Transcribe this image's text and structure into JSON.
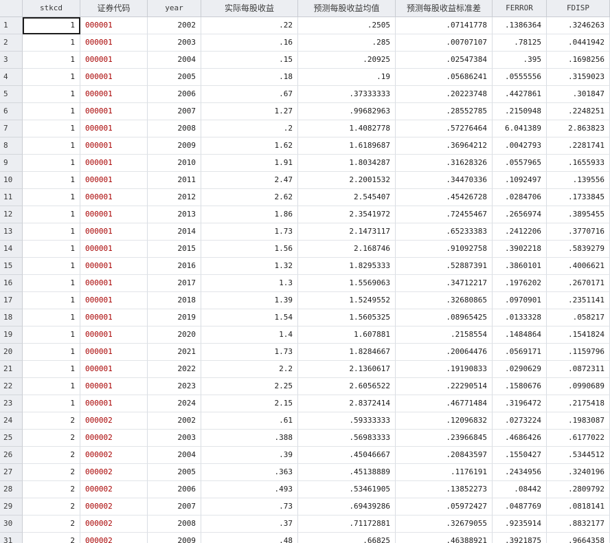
{
  "columns": [
    "stkcd",
    "证券代码",
    "year",
    "实际每股收益",
    "预测每股收益均值",
    "预测每股收益标准差",
    "FERROR",
    "FDISP"
  ],
  "rows": [
    {
      "n": "1",
      "stkcd": "1",
      "code": "000001",
      "year": "2002",
      "eps": ".22",
      "fmean": ".2505",
      "fsd": ".07141778",
      "ferror": ".1386364",
      "fdisp": ".3246263"
    },
    {
      "n": "2",
      "stkcd": "1",
      "code": "000001",
      "year": "2003",
      "eps": ".16",
      "fmean": ".285",
      "fsd": ".00707107",
      "ferror": ".78125",
      "fdisp": ".0441942"
    },
    {
      "n": "3",
      "stkcd": "1",
      "code": "000001",
      "year": "2004",
      "eps": ".15",
      "fmean": ".20925",
      "fsd": ".02547384",
      "ferror": ".395",
      "fdisp": ".1698256"
    },
    {
      "n": "4",
      "stkcd": "1",
      "code": "000001",
      "year": "2005",
      "eps": ".18",
      "fmean": ".19",
      "fsd": ".05686241",
      "ferror": ".0555556",
      "fdisp": ".3159023"
    },
    {
      "n": "5",
      "stkcd": "1",
      "code": "000001",
      "year": "2006",
      "eps": ".67",
      "fmean": ".37333333",
      "fsd": ".20223748",
      "ferror": ".4427861",
      "fdisp": ".301847"
    },
    {
      "n": "6",
      "stkcd": "1",
      "code": "000001",
      "year": "2007",
      "eps": "1.27",
      "fmean": ".99682963",
      "fsd": ".28552785",
      "ferror": ".2150948",
      "fdisp": ".2248251"
    },
    {
      "n": "7",
      "stkcd": "1",
      "code": "000001",
      "year": "2008",
      "eps": ".2",
      "fmean": "1.4082778",
      "fsd": ".57276464",
      "ferror": "6.041389",
      "fdisp": "2.863823"
    },
    {
      "n": "8",
      "stkcd": "1",
      "code": "000001",
      "year": "2009",
      "eps": "1.62",
      "fmean": "1.6189687",
      "fsd": ".36964212",
      "ferror": ".0042793",
      "fdisp": ".2281741"
    },
    {
      "n": "9",
      "stkcd": "1",
      "code": "000001",
      "year": "2010",
      "eps": "1.91",
      "fmean": "1.8034287",
      "fsd": ".31628326",
      "ferror": ".0557965",
      "fdisp": ".1655933"
    },
    {
      "n": "10",
      "stkcd": "1",
      "code": "000001",
      "year": "2011",
      "eps": "2.47",
      "fmean": "2.2001532",
      "fsd": ".34470336",
      "ferror": ".1092497",
      "fdisp": ".139556"
    },
    {
      "n": "11",
      "stkcd": "1",
      "code": "000001",
      "year": "2012",
      "eps": "2.62",
      "fmean": "2.545407",
      "fsd": ".45426728",
      "ferror": ".0284706",
      "fdisp": ".1733845"
    },
    {
      "n": "12",
      "stkcd": "1",
      "code": "000001",
      "year": "2013",
      "eps": "1.86",
      "fmean": "2.3541972",
      "fsd": ".72455467",
      "ferror": ".2656974",
      "fdisp": ".3895455"
    },
    {
      "n": "13",
      "stkcd": "1",
      "code": "000001",
      "year": "2014",
      "eps": "1.73",
      "fmean": "2.1473117",
      "fsd": ".65233383",
      "ferror": ".2412206",
      "fdisp": ".3770716"
    },
    {
      "n": "14",
      "stkcd": "1",
      "code": "000001",
      "year": "2015",
      "eps": "1.56",
      "fmean": "2.168746",
      "fsd": ".91092758",
      "ferror": ".3902218",
      "fdisp": ".5839279"
    },
    {
      "n": "15",
      "stkcd": "1",
      "code": "000001",
      "year": "2016",
      "eps": "1.32",
      "fmean": "1.8295333",
      "fsd": ".52887391",
      "ferror": ".3860101",
      "fdisp": ".4006621"
    },
    {
      "n": "16",
      "stkcd": "1",
      "code": "000001",
      "year": "2017",
      "eps": "1.3",
      "fmean": "1.5569063",
      "fsd": ".34712217",
      "ferror": ".1976202",
      "fdisp": ".2670171"
    },
    {
      "n": "17",
      "stkcd": "1",
      "code": "000001",
      "year": "2018",
      "eps": "1.39",
      "fmean": "1.5249552",
      "fsd": ".32680865",
      "ferror": ".0970901",
      "fdisp": ".2351141"
    },
    {
      "n": "18",
      "stkcd": "1",
      "code": "000001",
      "year": "2019",
      "eps": "1.54",
      "fmean": "1.5605325",
      "fsd": ".08965425",
      "ferror": ".0133328",
      "fdisp": ".058217"
    },
    {
      "n": "19",
      "stkcd": "1",
      "code": "000001",
      "year": "2020",
      "eps": "1.4",
      "fmean": "1.607881",
      "fsd": ".2158554",
      "ferror": ".1484864",
      "fdisp": ".1541824"
    },
    {
      "n": "20",
      "stkcd": "1",
      "code": "000001",
      "year": "2021",
      "eps": "1.73",
      "fmean": "1.8284667",
      "fsd": ".20064476",
      "ferror": ".0569171",
      "fdisp": ".1159796"
    },
    {
      "n": "21",
      "stkcd": "1",
      "code": "000001",
      "year": "2022",
      "eps": "2.2",
      "fmean": "2.1360617",
      "fsd": ".19190833",
      "ferror": ".0290629",
      "fdisp": ".0872311"
    },
    {
      "n": "22",
      "stkcd": "1",
      "code": "000001",
      "year": "2023",
      "eps": "2.25",
      "fmean": "2.6056522",
      "fsd": ".22290514",
      "ferror": ".1580676",
      "fdisp": ".0990689"
    },
    {
      "n": "23",
      "stkcd": "1",
      "code": "000001",
      "year": "2024",
      "eps": "2.15",
      "fmean": "2.8372414",
      "fsd": ".46771484",
      "ferror": ".3196472",
      "fdisp": ".2175418"
    },
    {
      "n": "24",
      "stkcd": "2",
      "code": "000002",
      "year": "2002",
      "eps": ".61",
      "fmean": ".59333333",
      "fsd": ".12096832",
      "ferror": ".0273224",
      "fdisp": ".1983087"
    },
    {
      "n": "25",
      "stkcd": "2",
      "code": "000002",
      "year": "2003",
      "eps": ".388",
      "fmean": ".56983333",
      "fsd": ".23966845",
      "ferror": ".4686426",
      "fdisp": ".6177022"
    },
    {
      "n": "26",
      "stkcd": "2",
      "code": "000002",
      "year": "2004",
      "eps": ".39",
      "fmean": ".45046667",
      "fsd": ".20843597",
      "ferror": ".1550427",
      "fdisp": ".5344512"
    },
    {
      "n": "27",
      "stkcd": "2",
      "code": "000002",
      "year": "2005",
      "eps": ".363",
      "fmean": ".45138889",
      "fsd": ".1176191",
      "ferror": ".2434956",
      "fdisp": ".3240196"
    },
    {
      "n": "28",
      "stkcd": "2",
      "code": "000002",
      "year": "2006",
      "eps": ".493",
      "fmean": ".53461905",
      "fsd": ".13852273",
      "ferror": ".08442",
      "fdisp": ".2809792"
    },
    {
      "n": "29",
      "stkcd": "2",
      "code": "000002",
      "year": "2007",
      "eps": ".73",
      "fmean": ".69439286",
      "fsd": ".05972427",
      "ferror": ".0487769",
      "fdisp": ".0818141"
    },
    {
      "n": "30",
      "stkcd": "2",
      "code": "000002",
      "year": "2008",
      "eps": ".37",
      "fmean": ".71172881",
      "fsd": ".32679055",
      "ferror": ".9235914",
      "fdisp": ".8832177"
    },
    {
      "n": "31",
      "stkcd": "2",
      "code": "000002",
      "year": "2009",
      "eps": ".48",
      "fmean": ".66825",
      "fsd": ".46388921",
      "ferror": ".3921875",
      "fdisp": ".9664358"
    }
  ]
}
